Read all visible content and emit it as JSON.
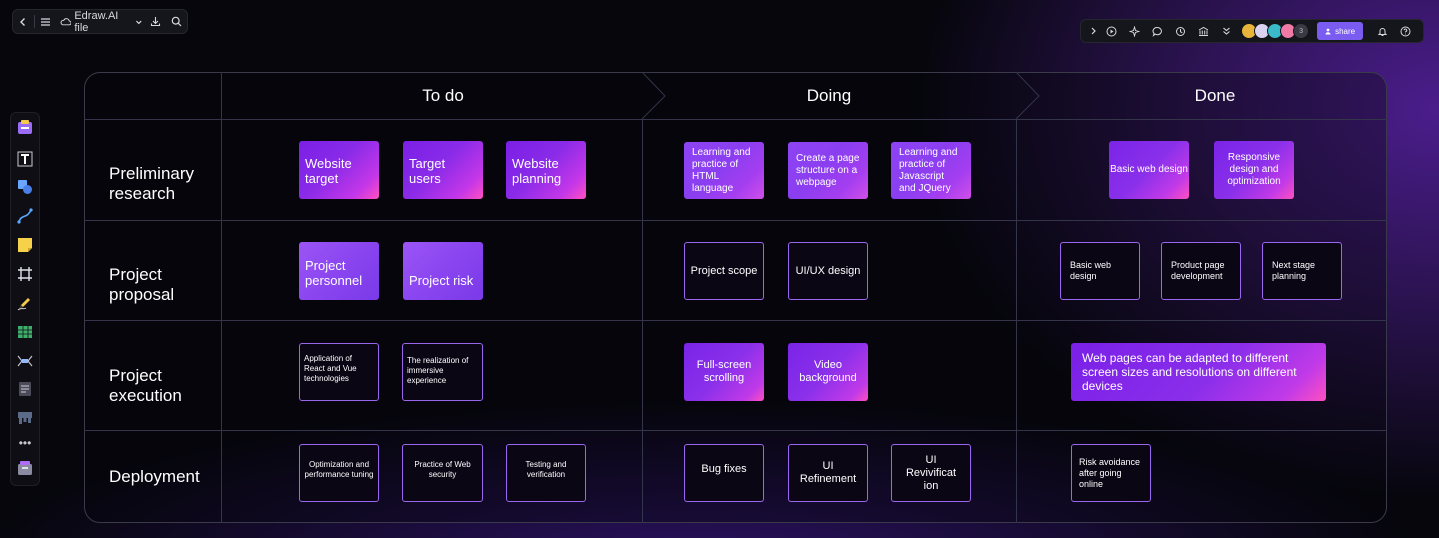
{
  "toolbar_left": {
    "file_name": "Edraw.AI file"
  },
  "toolbar_right": {
    "avatar_extra_count": "3",
    "share_label": "share"
  },
  "board": {
    "columns": [
      "To do",
      "Doing",
      "Done"
    ],
    "rows": [
      {
        "label": "Preliminary\nresearch"
      },
      {
        "label": "Project\nproposal"
      },
      {
        "label": "Project\nexecution"
      },
      {
        "label": "Deployment"
      }
    ],
    "cards": {
      "r1_todo": [
        "Website target",
        "Target users",
        "Website planning"
      ],
      "r1_doing": [
        "Learning and practice of HTML language",
        "Create a page structure on a webpage",
        "Learning and practice of Javascript and JQuery"
      ],
      "r1_done": [
        "Basic web design",
        "Responsive design and optimization"
      ],
      "r2_todo": [
        "Project personnel",
        "Project risk"
      ],
      "r2_doing": [
        "Project scope",
        "UI/UX design"
      ],
      "r2_done": [
        "Basic web design",
        "Product page development",
        "Next stage planning"
      ],
      "r3_todo": [
        "Application of React and Vue technologies",
        "The realization of immersive experience"
      ],
      "r3_doing": [
        "Full-screen scrolling",
        "Video background"
      ],
      "r3_done": [
        "Web pages can be adapted to different screen sizes and resolutions on different devices"
      ],
      "r4_todo": [
        "Optimization and performance tuning",
        "Practice of Web security",
        "Testing and verification"
      ],
      "r4_doing": [
        "Bug fixes",
        "UI Refinement",
        "UI Revivificat ion"
      ],
      "r4_done": [
        "Risk avoidance after going online"
      ]
    }
  },
  "colors": {
    "accent": "#7b5cf0",
    "card_border": "#9a66f0",
    "gradient_start": "#7a1fe6",
    "gradient_end": "#ff4fc0"
  }
}
